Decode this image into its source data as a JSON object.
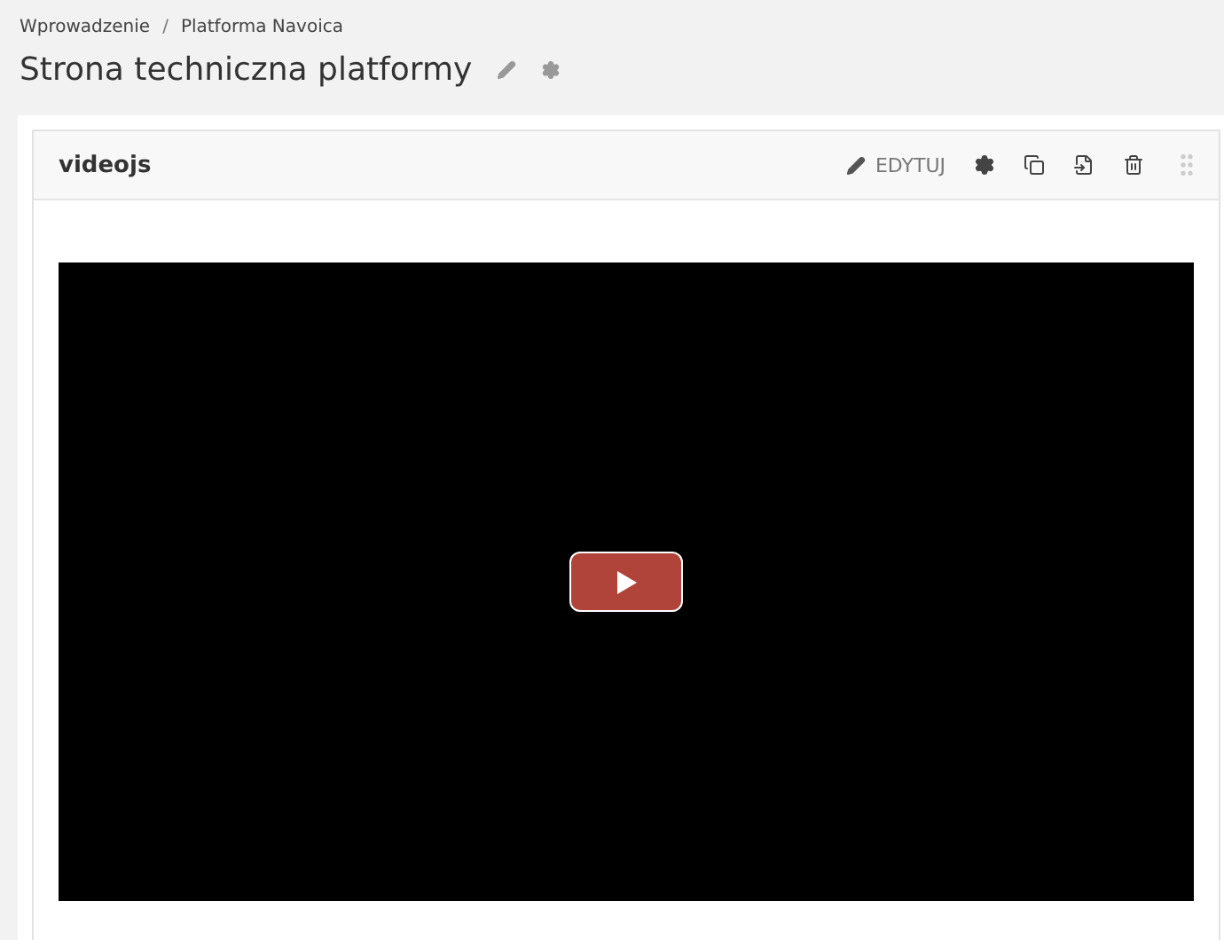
{
  "breadcrumb": [
    {
      "label": "Wprowadzenie"
    },
    {
      "label": "Platforma Navoica"
    }
  ],
  "breadcrumb_separator": "/",
  "page_title": "Strona techniczna platformy",
  "block": {
    "title": "videojs",
    "edit_label": "EDYTUJ"
  }
}
